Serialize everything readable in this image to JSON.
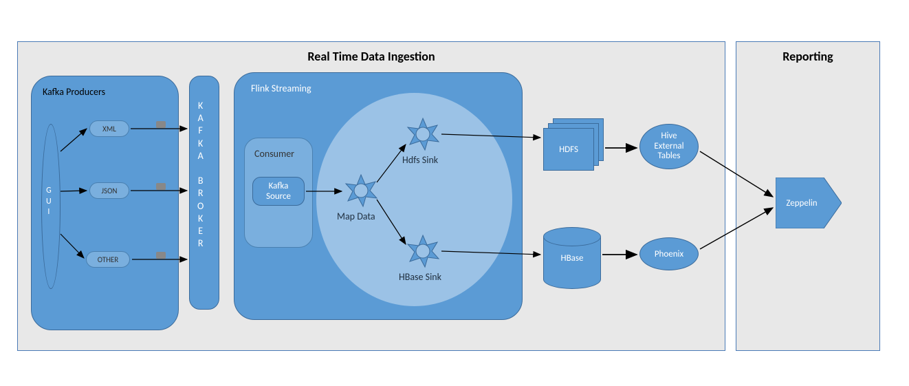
{
  "panels": {
    "ingestion_title": "Real Time Data Ingestion",
    "reporting_title": "Reporting"
  },
  "producers": {
    "group_label": "Kafka Producers",
    "gui_label": "G\nU\nI",
    "items": [
      "XML",
      "JSON",
      "OTHER"
    ]
  },
  "broker": {
    "label": "K\nA\nF\nK\nA\n\nB\nR\nO\nK\nE\nR"
  },
  "flink": {
    "group_label": "Flink Streaming",
    "consumer_label": "Consumer",
    "kafka_source": "Kafka\nSource",
    "map_data": "Map Data",
    "hdfs_sink": "Hdfs Sink",
    "hbase_sink": "HBase Sink"
  },
  "stores": {
    "hdfs": "HDFS",
    "hbase": "HBase",
    "hive": "Hive\nExternal\nTables",
    "phoenix": "Phoenix"
  },
  "reporting": {
    "zeppelin": "Zeppelin"
  }
}
